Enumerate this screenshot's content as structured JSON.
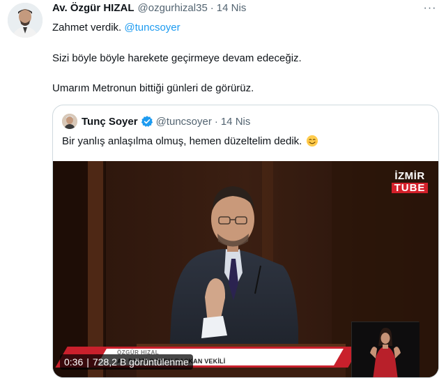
{
  "tweet": {
    "author_name": "Av. Özgür HIZAL",
    "author_handle": "@ozgurhizal35",
    "separator": "·",
    "date": "14 Nis",
    "more_label": "···",
    "line1_prefix": "Zahmet verdik.",
    "line1_mention": "@tuncsoyer",
    "line2": "Sizi böyle böyle harekete geçirmeye devam edeceğiz.",
    "line3": "Umarım Metronun bittiği günleri de görürüz."
  },
  "quote": {
    "author_name": "Tunç Soyer",
    "author_handle": "@tuncsoyer",
    "separator": "·",
    "date": "14 Nis",
    "text": "Bir yanlış anlaşılma olmuş, hemen düzeltelim dedik.",
    "emoji_icon": "smiling-face-emoji"
  },
  "video": {
    "brand_line1": "İZMİR",
    "brand_line2": "TUBE",
    "lower_third_name": "ÖZGÜR HIZAL",
    "lower_third_title": "AK PARTİ GRUBU BAŞKAN VEKİLİ",
    "duration": "0:36",
    "badge_separator": "|",
    "views": "728,2 B görüntülenme"
  },
  "colors": {
    "link": "#1d9bf0",
    "muted": "#536471",
    "verified": "#1d9bf0",
    "brand_red": "#d4202a"
  }
}
